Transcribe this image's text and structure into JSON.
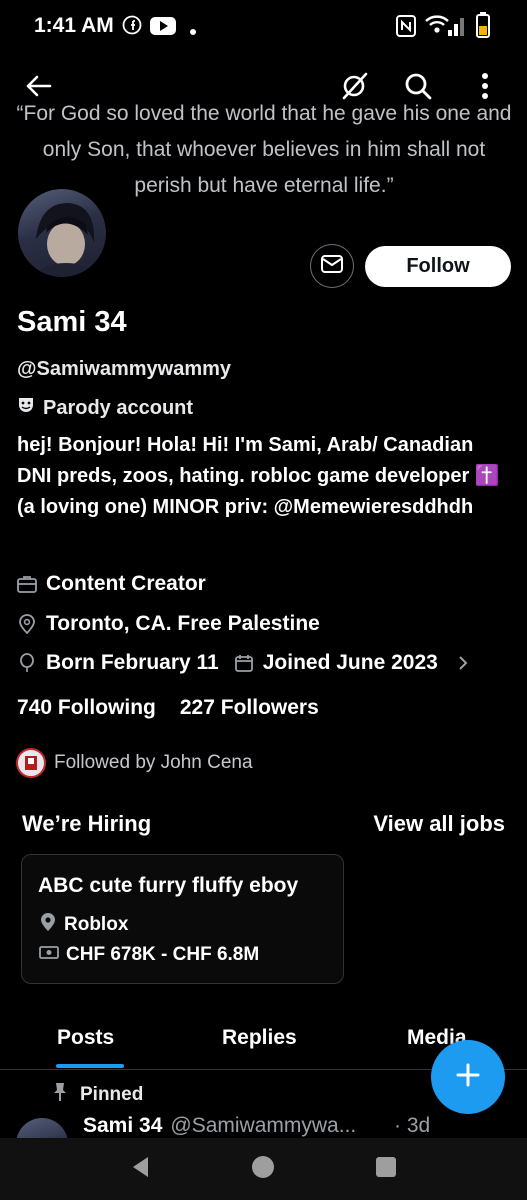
{
  "status_bar": {
    "time": "1:41 AM",
    "icons": [
      "facebook-icon",
      "youtube-icon",
      "dot-icon",
      "nfc-icon",
      "wifi-icon",
      "signal-icon",
      "battery-icon"
    ]
  },
  "banner": {
    "quote": "“For God so loved the world that he gave his one and only Son, that whoever believes in him shall not perish but have eternal life.”"
  },
  "top_actions": {
    "icons": [
      "back-arrow-icon",
      "grok-icon",
      "search-icon",
      "more-vert-icon"
    ]
  },
  "profile": {
    "follow_label": "Follow",
    "name": "Sami 34",
    "handle": "@Samiwammywammy",
    "parody_label": "Parody account",
    "bio": "hej! Bonjour! Hola! Hi!  I'm Sami, Arab/ Canadian DNI preds, zoos, hating. robloc game developer  ✝️ (a loving one) MINOR priv: @Memewieresddhdh",
    "category": "Content Creator",
    "location": "Toronto, CA. Free Palestine",
    "born": "Born February 11",
    "joined": "Joined June 2023",
    "following_count": "740",
    "following_label": "Following",
    "followers_count": "227",
    "followers_label": "Followers",
    "followed_by": "Followed by John Cena"
  },
  "hiring": {
    "title": "We’re Hiring",
    "view_all": "View all jobs",
    "job": {
      "title": "ABC cute furry fluffy eboy",
      "location": "Roblox",
      "salary": "CHF 678K - CHF 6.8M"
    }
  },
  "tabs": [
    {
      "label": "Posts",
      "active": true
    },
    {
      "label": "Replies",
      "active": false
    },
    {
      "label": "Media",
      "active": false
    }
  ],
  "pinned_post": {
    "pinned_label": "Pinned",
    "name": "Sami 34",
    "handle": "@Samiwammywa...",
    "time": "· 3d"
  },
  "colors": {
    "background": "#000000",
    "accent": "#1d9bf0",
    "text": "#e7e9ea",
    "muted": "#9aa0a6",
    "follow_button_bg": "#ffffff"
  }
}
